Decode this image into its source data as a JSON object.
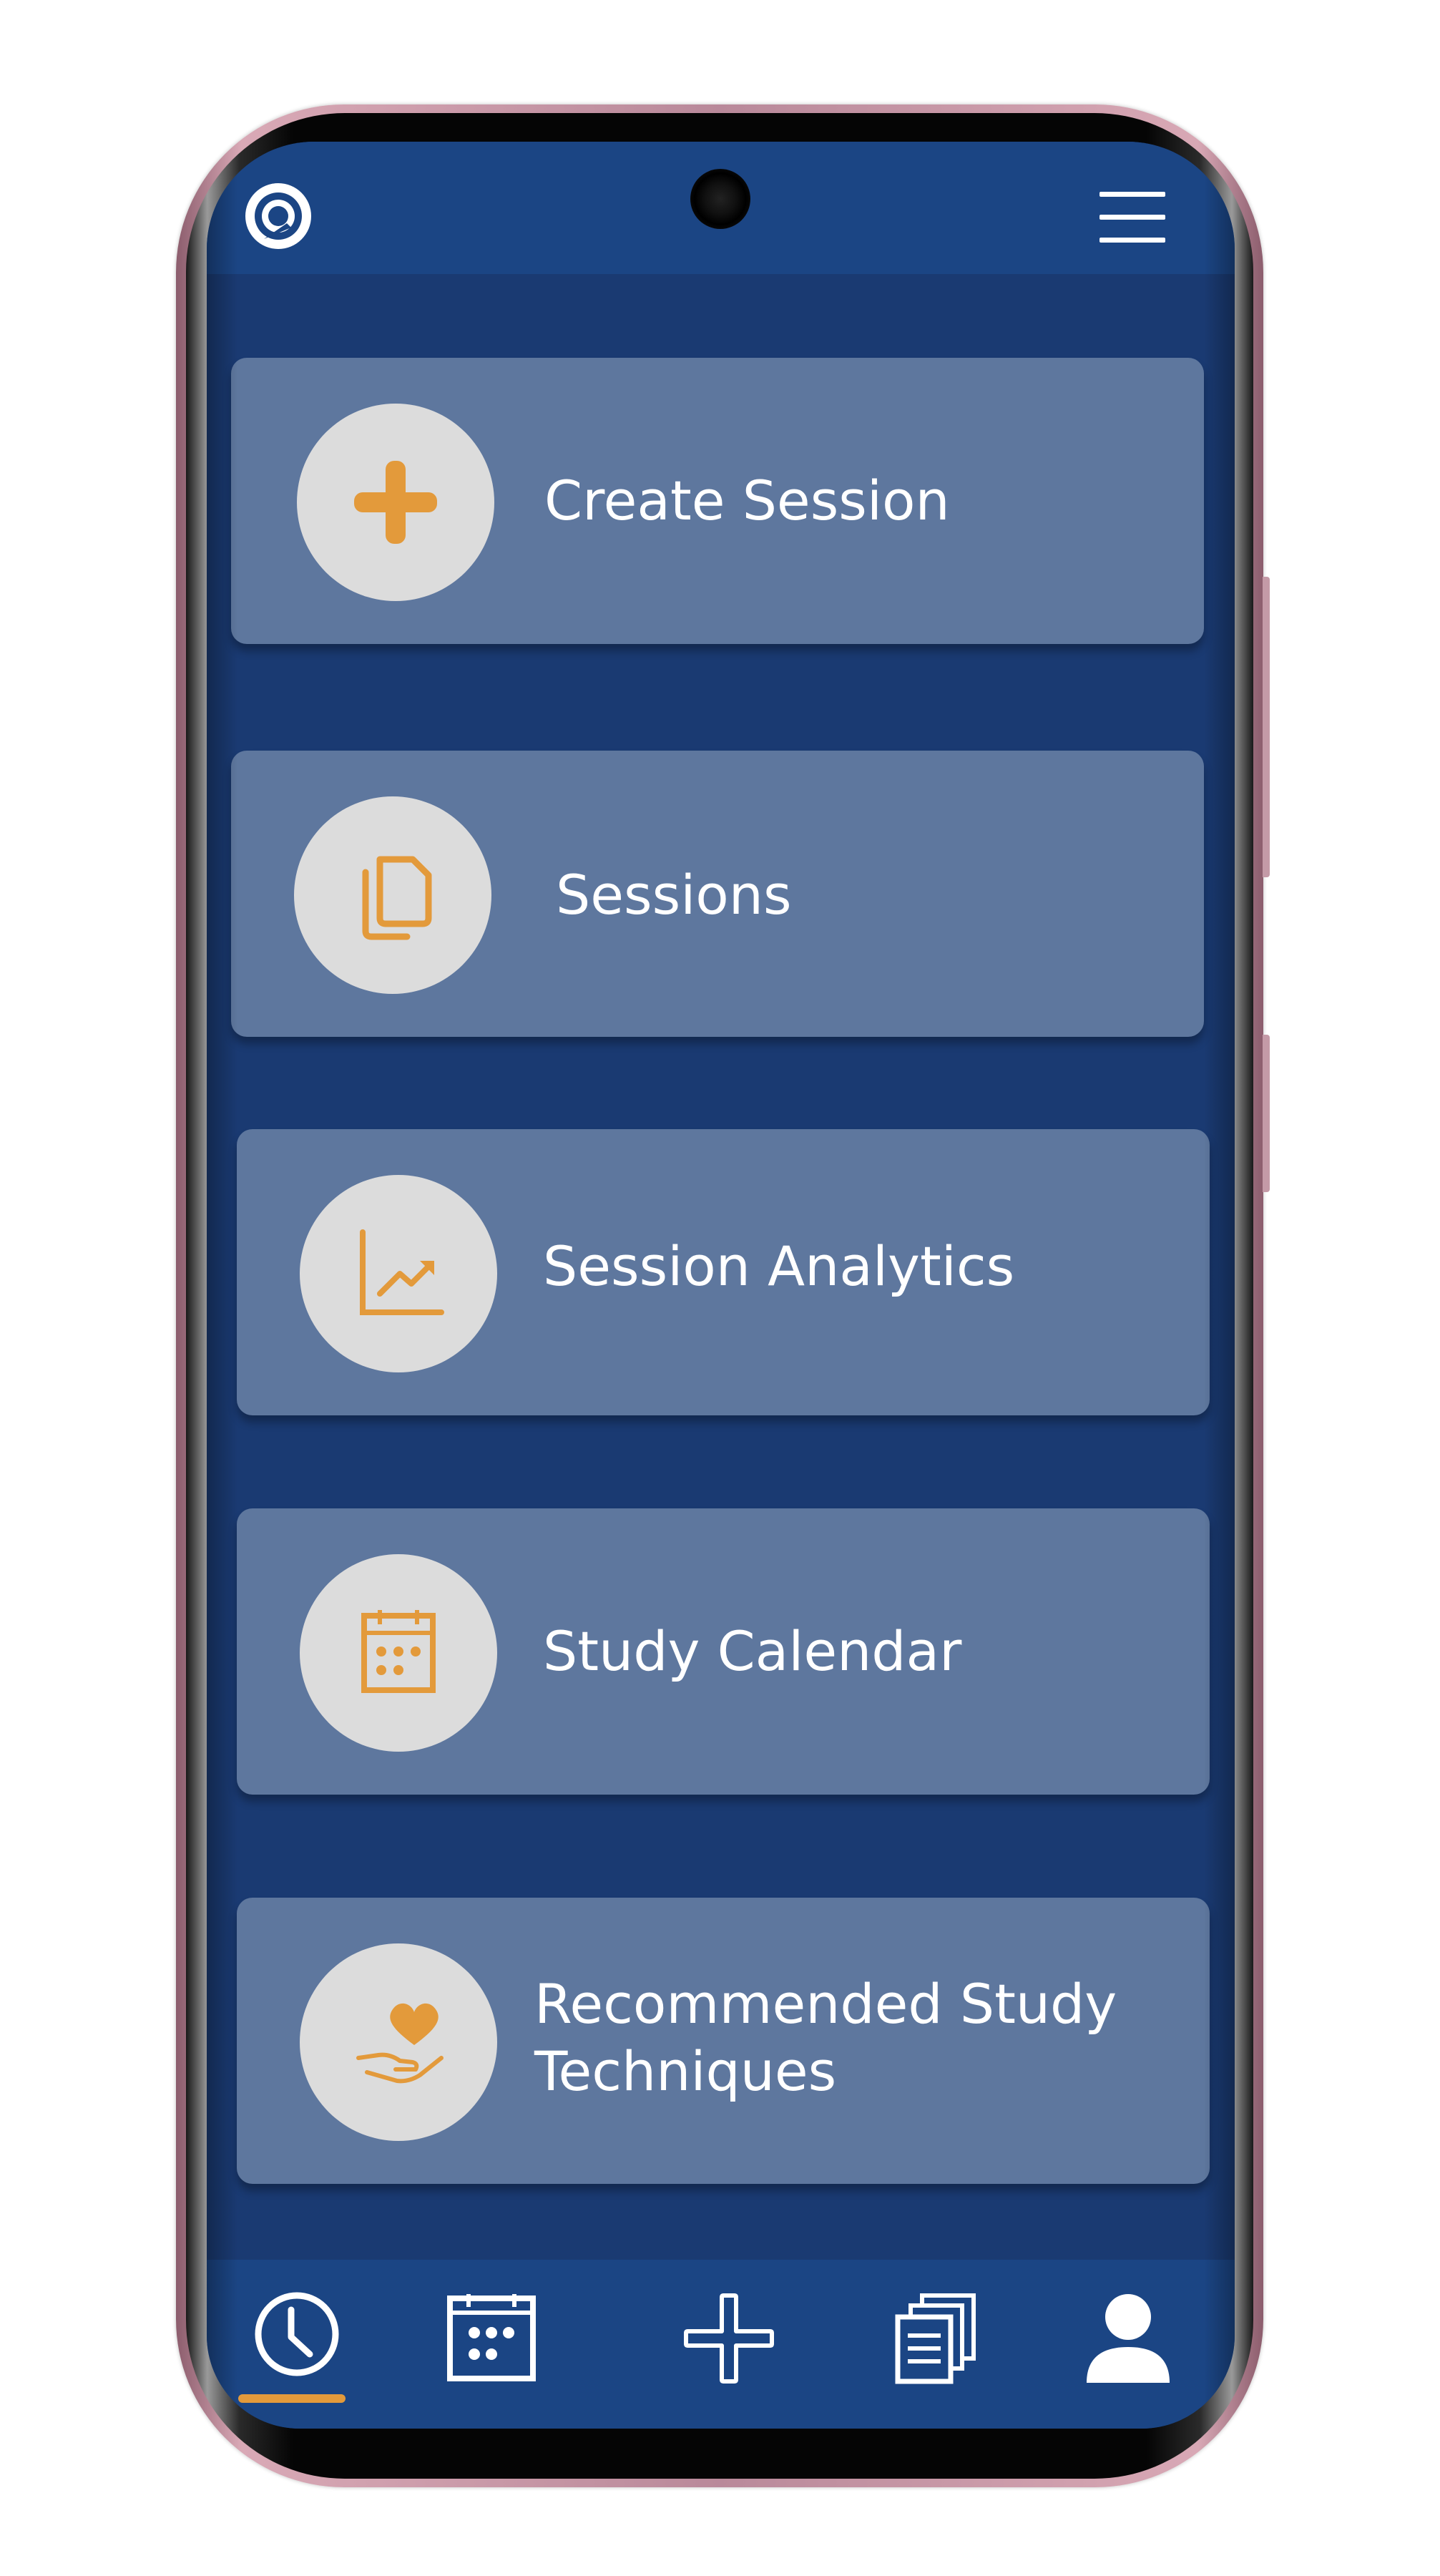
{
  "app": {
    "accent_color": "#e39a3b",
    "header_color": "#1b4584",
    "background_color": "#1a3a72",
    "card_color": "#5e779e"
  },
  "header": {
    "logo_icon": "app-logo-icon",
    "menu_icon": "hamburger-menu-icon"
  },
  "cards": [
    {
      "label": "Create Session",
      "icon": "plus-icon"
    },
    {
      "label": "Sessions",
      "icon": "documents-icon"
    },
    {
      "label": "Session Analytics",
      "icon": "chart-icon"
    },
    {
      "label": "Study Calendar",
      "icon": "calendar-icon"
    },
    {
      "label_line1": "Recommended Study",
      "label_line2": "Techniques",
      "icon": "heart-hand-icon"
    }
  ],
  "bottom_nav": {
    "active_index": 0,
    "items": [
      {
        "icon": "clock-icon"
      },
      {
        "icon": "calendar-icon"
      },
      {
        "icon": "plus-icon"
      },
      {
        "icon": "documents-icon"
      },
      {
        "icon": "profile-icon"
      }
    ]
  }
}
